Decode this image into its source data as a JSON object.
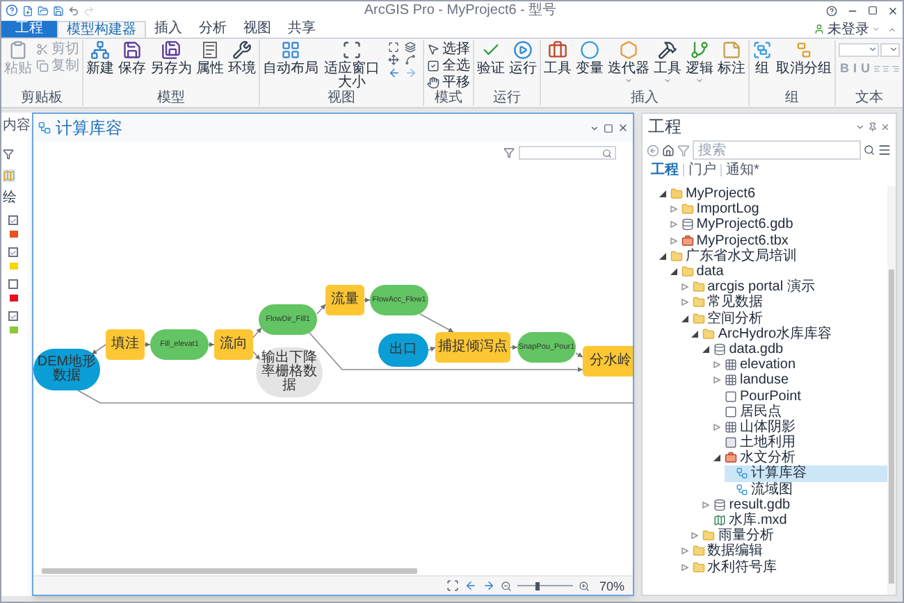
{
  "window": {
    "title": "ArcGIS Pro - MyProject6 - 型号",
    "account": "未登录"
  },
  "ribbon_tabs": [
    {
      "label": "工程",
      "kind": "file",
      "selected": false
    },
    {
      "label": "模型构建器",
      "kind": "tab",
      "selected": true
    },
    {
      "label": "插入",
      "kind": "tab",
      "selected": false
    },
    {
      "label": "分析",
      "kind": "tab",
      "selected": false
    },
    {
      "label": "视图",
      "kind": "tab",
      "selected": false
    },
    {
      "label": "共享",
      "kind": "tab",
      "selected": false
    }
  ],
  "ribbon_groups": [
    {
      "label": "剪贴板",
      "buttons": [
        {
          "label": "粘贴",
          "kind": "large",
          "disabled": true
        },
        {
          "label": "剪切",
          "kind": "small",
          "disabled": true
        },
        {
          "label": "复制",
          "kind": "small",
          "disabled": true
        }
      ]
    },
    {
      "label": "模型",
      "buttons": [
        {
          "label": "新建",
          "kind": "large",
          "disabled": false
        },
        {
          "label": "保存",
          "kind": "large",
          "disabled": false
        },
        {
          "label": "另存为",
          "kind": "large",
          "disabled": false
        },
        {
          "label": "属性",
          "kind": "large",
          "disabled": false
        },
        {
          "label": "环境",
          "kind": "large",
          "disabled": false
        }
      ]
    },
    {
      "label": "视图",
      "buttons": [
        {
          "label": "自动布局",
          "kind": "large",
          "disabled": false
        },
        {
          "label": "适应窗口大小",
          "kind": "large",
          "disabled": false
        },
        {
          "kind": "icon-grid"
        }
      ]
    },
    {
      "label": "模式",
      "buttons": [
        {
          "label": "选择",
          "kind": "small",
          "disabled": false
        },
        {
          "label": "全选",
          "kind": "small",
          "disabled": false
        },
        {
          "label": "平移",
          "kind": "small",
          "disabled": false
        }
      ]
    },
    {
      "label": "运行",
      "buttons": [
        {
          "label": "验证",
          "kind": "large",
          "disabled": false
        },
        {
          "label": "运行",
          "kind": "large",
          "disabled": false
        }
      ]
    },
    {
      "label": "插入",
      "buttons": [
        {
          "label": "工具",
          "kind": "large",
          "disabled": false
        },
        {
          "label": "变量",
          "kind": "large",
          "disabled": false
        },
        {
          "label": "迭代器",
          "kind": "menu",
          "disabled": false
        },
        {
          "label": "工具",
          "kind": "menu",
          "disabled": false
        },
        {
          "label": "逻辑",
          "kind": "menu",
          "disabled": false
        },
        {
          "label": "标注",
          "kind": "large",
          "disabled": false
        }
      ]
    },
    {
      "label": "组",
      "buttons": [
        {
          "label": "组",
          "kind": "large",
          "disabled": false
        },
        {
          "label": "取消分组",
          "kind": "large",
          "disabled": false
        }
      ]
    }
  ],
  "text_group": {
    "label": "文本",
    "format_buttons": [
      {
        "label": "B",
        "disabled": true
      },
      {
        "label": "I",
        "disabled": true
      },
      {
        "label": "U",
        "disabled": true
      }
    ]
  },
  "contents_panel": {
    "title": "内容",
    "heading": "绘",
    "layers": [
      {
        "checked": true,
        "color": "#e8501e"
      },
      {
        "checked": true,
        "color": "#f5d90a"
      },
      {
        "checked": false,
        "color": "#e8101e"
      },
      {
        "checked": true,
        "color": "#8cc83c"
      }
    ]
  },
  "model_window": {
    "title": "计算库容",
    "nodes": [
      {
        "label": "DEM地形数据",
        "kind": "input"
      },
      {
        "label": "填洼",
        "kind": "tool"
      },
      {
        "label": "Fill_elevat1",
        "kind": "derived"
      },
      {
        "label": "流向",
        "kind": "tool"
      },
      {
        "label": "FlowDir_Fill1",
        "kind": "derived"
      },
      {
        "label": "输出下降率栅格数据",
        "kind": "intermediate"
      },
      {
        "label": "流量",
        "kind": "tool"
      },
      {
        "label": "FlowAcc_Flow1",
        "kind": "derived"
      },
      {
        "label": "出口",
        "kind": "input"
      },
      {
        "label": "捕捉倾泻点",
        "kind": "tool"
      },
      {
        "label": "SnapPou_Pour1",
        "kind": "derived"
      },
      {
        "label": "分水岭",
        "kind": "tool"
      }
    ],
    "zoom_slider": {
      "level": 0.35
    },
    "zoom": "70%"
  },
  "project_panel": {
    "title": "工程",
    "search": {
      "placeholder": "搜索"
    },
    "tabs": [
      {
        "label": "工程",
        "selected": true
      },
      {
        "label": "门户",
        "selected": false
      },
      {
        "label": "通知*",
        "selected": false
      }
    ],
    "tree": [
      {
        "label": "MyProject6",
        "kind": "project",
        "expanded": true,
        "selected": false,
        "children": [
          {
            "label": "ImportLog",
            "kind": "folder",
            "expanded": false,
            "selected": false
          },
          {
            "label": "MyProject6.gdb",
            "kind": "gdb",
            "expanded": false,
            "selected": false
          },
          {
            "label": "MyProject6.tbx",
            "kind": "toolbox",
            "expanded": false,
            "selected": false
          }
        ]
      },
      {
        "label": "广东省水文局培训",
        "kind": "folder",
        "expanded": true,
        "selected": false,
        "children": [
          {
            "label": "data",
            "kind": "folder",
            "expanded": true,
            "selected": false,
            "children": [
              {
                "label": "arcgis portal 演示",
                "kind": "folder",
                "expanded": false,
                "selected": false
              },
              {
                "label": "常见数据",
                "kind": "folder",
                "expanded": false,
                "selected": false
              },
              {
                "label": "空间分析",
                "kind": "folder",
                "expanded": true,
                "selected": false,
                "children": [
                  {
                    "label": "ArcHydro水库库容",
                    "kind": "folder",
                    "expanded": true,
                    "selected": false,
                    "children": [
                      {
                        "label": "data.gdb",
                        "kind": "gdb",
                        "expanded": true,
                        "selected": false,
                        "children": [
                          {
                            "label": "elevation",
                            "kind": "raster",
                            "expanded": false,
                            "selected": false
                          },
                          {
                            "label": "landuse",
                            "kind": "raster",
                            "expanded": false,
                            "selected": false
                          },
                          {
                            "label": "PourPoint",
                            "kind": "point",
                            "selected": false
                          },
                          {
                            "label": "居民点",
                            "kind": "point",
                            "selected": false
                          },
                          {
                            "label": "山体阴影",
                            "kind": "raster",
                            "expanded": false,
                            "selected": false
                          },
                          {
                            "label": "土地利用",
                            "kind": "polygon",
                            "selected": false
                          },
                          {
                            "label": "水文分析",
                            "kind": "toolbox",
                            "expanded": true,
                            "selected": false,
                            "children": [
                              {
                                "label": "计算库容",
                                "kind": "model",
                                "selected": true
                              },
                              {
                                "label": "流域图",
                                "kind": "model",
                                "selected": false
                              }
                            ]
                          }
                        ]
                      },
                      {
                        "label": "result.gdb",
                        "kind": "gdb",
                        "expanded": false,
                        "selected": false
                      },
                      {
                        "label": "水库.mxd",
                        "kind": "mxd",
                        "selected": false
                      }
                    ]
                  },
                  {
                    "label": "雨量分析",
                    "kind": "folder",
                    "expanded": false,
                    "selected": false
                  }
                ]
              },
              {
                "label": "数据编辑",
                "kind": "folder",
                "expanded": false,
                "selected": false
              },
              {
                "label": "水利符号库",
                "kind": "folder",
                "expanded": false,
                "selected": false
              }
            ]
          }
        ]
      }
    ]
  }
}
